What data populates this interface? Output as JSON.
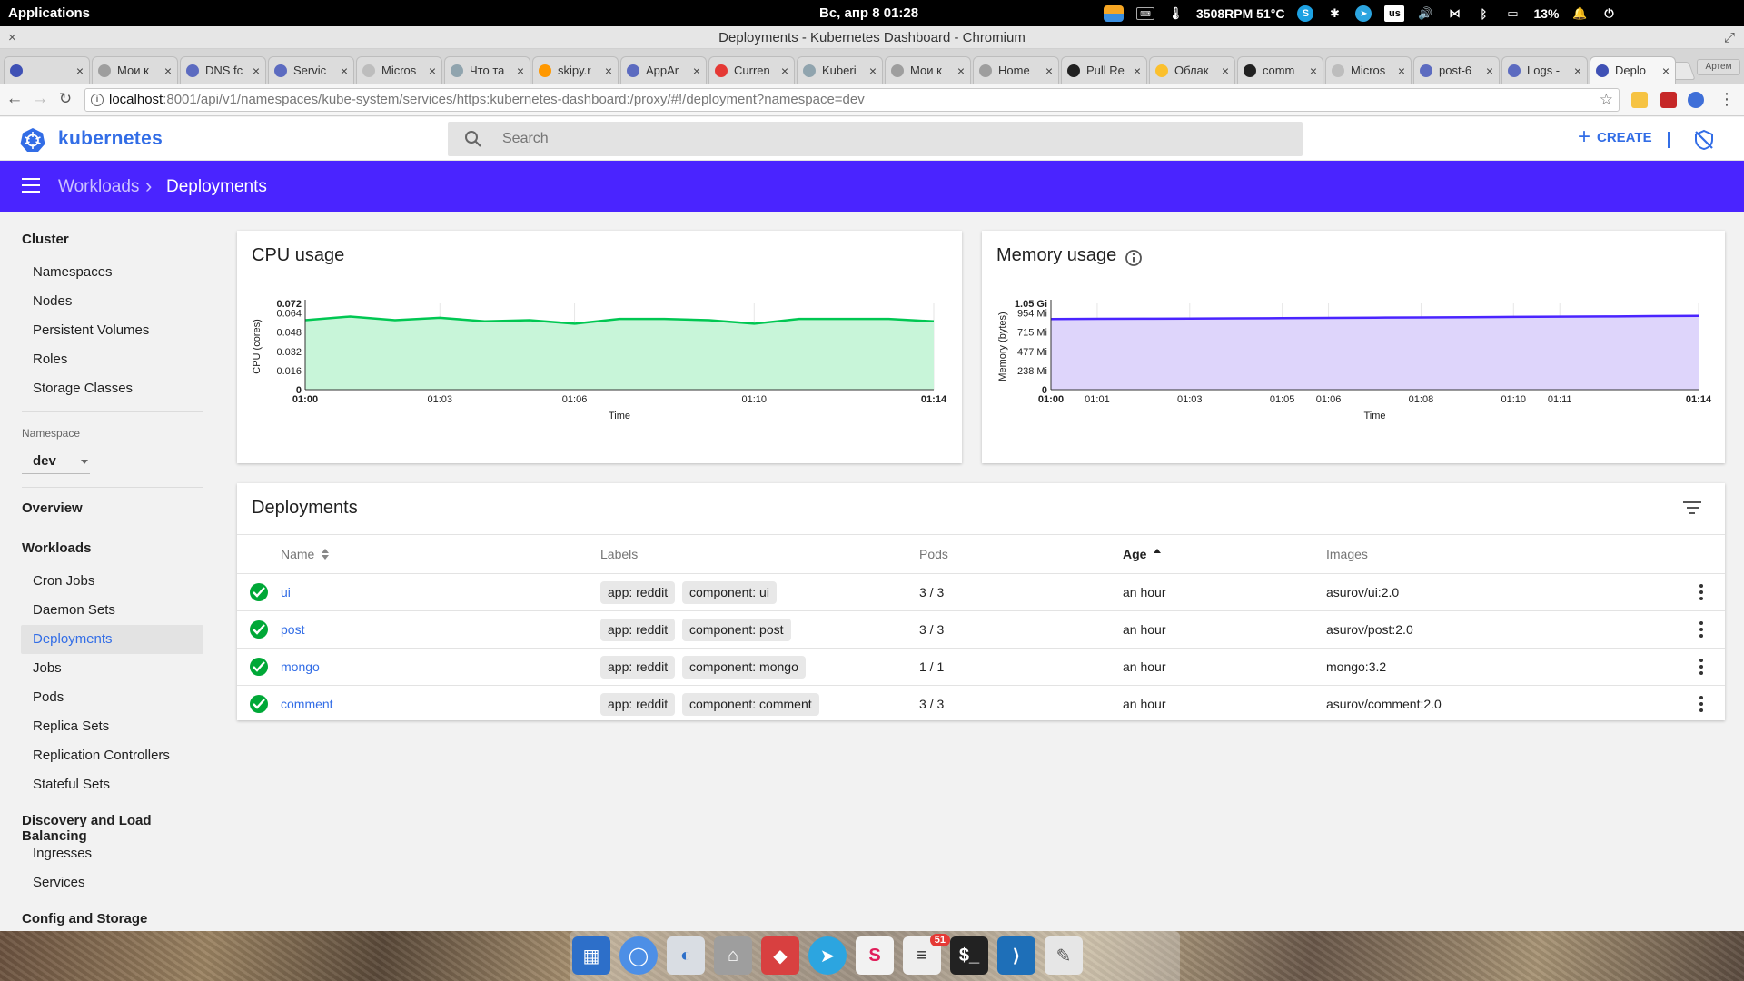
{
  "os": {
    "apps_label": "Applications",
    "clock": "Вс, апр  8   01:28",
    "fan_temp": "3508RPM 51°C",
    "layout": "us",
    "battery": "13%"
  },
  "window": {
    "title": "Deployments - Kubernetes Dashboard - Chromium"
  },
  "tabs": [
    {
      "label": "",
      "color": "#3f51b5"
    },
    {
      "label": "Мои к",
      "color": "#9e9e9e"
    },
    {
      "label": "DNS fc",
      "color": "#5c6bc0"
    },
    {
      "label": "Servic",
      "color": "#5c6bc0"
    },
    {
      "label": "Micros",
      "color": "#bdbdbd"
    },
    {
      "label": "Что та",
      "color": "#90a4ae"
    },
    {
      "label": "skipy.r",
      "color": "#ff9800"
    },
    {
      "label": "AppAr",
      "color": "#5c6bc0"
    },
    {
      "label": "Curren",
      "color": "#e53935"
    },
    {
      "label": "Kuberi",
      "color": "#90a4ae"
    },
    {
      "label": "Мои к",
      "color": "#9e9e9e"
    },
    {
      "label": "Home",
      "color": "#9e9e9e"
    },
    {
      "label": "Pull Re",
      "color": "#212121"
    },
    {
      "label": "Облак",
      "color": "#fbc02d"
    },
    {
      "label": "comm",
      "color": "#212121"
    },
    {
      "label": "Micros",
      "color": "#bdbdbd"
    },
    {
      "label": "post-6",
      "color": "#5c6bc0"
    },
    {
      "label": "Logs -",
      "color": "#5c6bc0"
    },
    {
      "label": "Deplo",
      "color": "#3f51b5"
    }
  ],
  "profile_label": "Артем",
  "omnibar": {
    "url_host": "localhost",
    "url_path": ":8001/api/v1/namespaces/kube-system/services/https:kubernetes-dashboard:/proxy/#!/deployment?namespace=dev"
  },
  "header": {
    "brand": "kubernetes",
    "search_placeholder": "Search",
    "create_label": "CREATE"
  },
  "breadcrumb": {
    "parent": "Workloads",
    "current": "Deployments",
    "separator": "›"
  },
  "sidebar": {
    "cluster_heading": "Cluster",
    "cluster_items": [
      "Namespaces",
      "Nodes",
      "Persistent Volumes",
      "Roles",
      "Storage Classes"
    ],
    "namespace_label": "Namespace",
    "namespace_value": "dev",
    "overview": "Overview",
    "workloads_heading": "Workloads",
    "workload_items": [
      "Cron Jobs",
      "Daemon Sets",
      "Deployments",
      "Jobs",
      "Pods",
      "Replica Sets",
      "Replication Controllers",
      "Stateful Sets"
    ],
    "active_item": "Deployments",
    "discovery_heading": "Discovery and Load Balancing",
    "discovery_items": [
      "Ingresses",
      "Services"
    ],
    "config_heading": "Config and Storage"
  },
  "chart_data": [
    {
      "type": "area",
      "title": "CPU usage",
      "xlabel": "Time",
      "ylabel": "CPU (cores)",
      "x": [
        "01:00",
        "01:01",
        "01:02",
        "01:03",
        "01:04",
        "01:05",
        "01:06",
        "01:07",
        "01:08",
        "01:09",
        "01:10",
        "01:11",
        "01:12",
        "01:13",
        "01:14"
      ],
      "x_ticks": [
        "01:00",
        "01:03",
        "01:06",
        "01:10",
        "01:14"
      ],
      "y_ticks": [
        "0",
        "0.016",
        "0.032",
        "0.048",
        "0.064",
        "0.072"
      ],
      "ylim": [
        0,
        0.072
      ],
      "values": [
        0.058,
        0.061,
        0.058,
        0.06,
        0.057,
        0.058,
        0.055,
        0.059,
        0.059,
        0.058,
        0.055,
        0.059,
        0.059,
        0.059,
        0.057
      ],
      "line_color": "#00c752",
      "fill_color": "#c8f5d9"
    },
    {
      "type": "area",
      "title": "Memory usage",
      "xlabel": "Time",
      "ylabel": "Memory (bytes)",
      "x": [
        "01:00",
        "01:01",
        "01:02",
        "01:03",
        "01:04",
        "01:05",
        "01:06",
        "01:07",
        "01:08",
        "01:09",
        "01:10",
        "01:11",
        "01:12",
        "01:13",
        "01:14"
      ],
      "x_ticks": [
        "01:00",
        "01:01",
        "01:03",
        "01:05",
        "01:06",
        "01:08",
        "01:10",
        "01:11",
        "01:14"
      ],
      "y_ticks": [
        "0",
        "238 Mi",
        "477 Mi",
        "715 Mi",
        "954 Mi",
        "1.05 Gi"
      ],
      "ylim_mib": [
        0,
        1075
      ],
      "values_mib": [
        880,
        882,
        884,
        886,
        888,
        891,
        894,
        897,
        900,
        903,
        906,
        909,
        912,
        916,
        920
      ],
      "line_color": "#4a24ff",
      "fill_color": "#ded5fb"
    }
  ],
  "deployments": {
    "title": "Deployments",
    "columns": {
      "name": "Name",
      "labels": "Labels",
      "pods": "Pods",
      "age": "Age",
      "images": "Images"
    },
    "rows": [
      {
        "name": "ui",
        "label1": "app: reddit",
        "label2": "component: ui",
        "pods": "3 / 3",
        "age": "an hour",
        "image": "asurov/ui:2.0"
      },
      {
        "name": "post",
        "label1": "app: reddit",
        "label2": "component: post",
        "pods": "3 / 3",
        "age": "an hour",
        "image": "asurov/post:2.0"
      },
      {
        "name": "mongo",
        "label1": "app: reddit",
        "label2": "component: mongo",
        "pods": "1 / 1",
        "age": "an hour",
        "image": "mongo:3.2"
      },
      {
        "name": "comment",
        "label1": "app: reddit",
        "label2": "component: comment",
        "pods": "3 / 3",
        "age": "an hour",
        "image": "asurov/comment:2.0"
      }
    ]
  },
  "dock": {
    "apps": [
      "workspaces",
      "chromium",
      "settings",
      "home-folder",
      "git-client",
      "telegram",
      "slack",
      "text-editor",
      "terminal",
      "vscode",
      "notes"
    ],
    "badge": "51"
  }
}
